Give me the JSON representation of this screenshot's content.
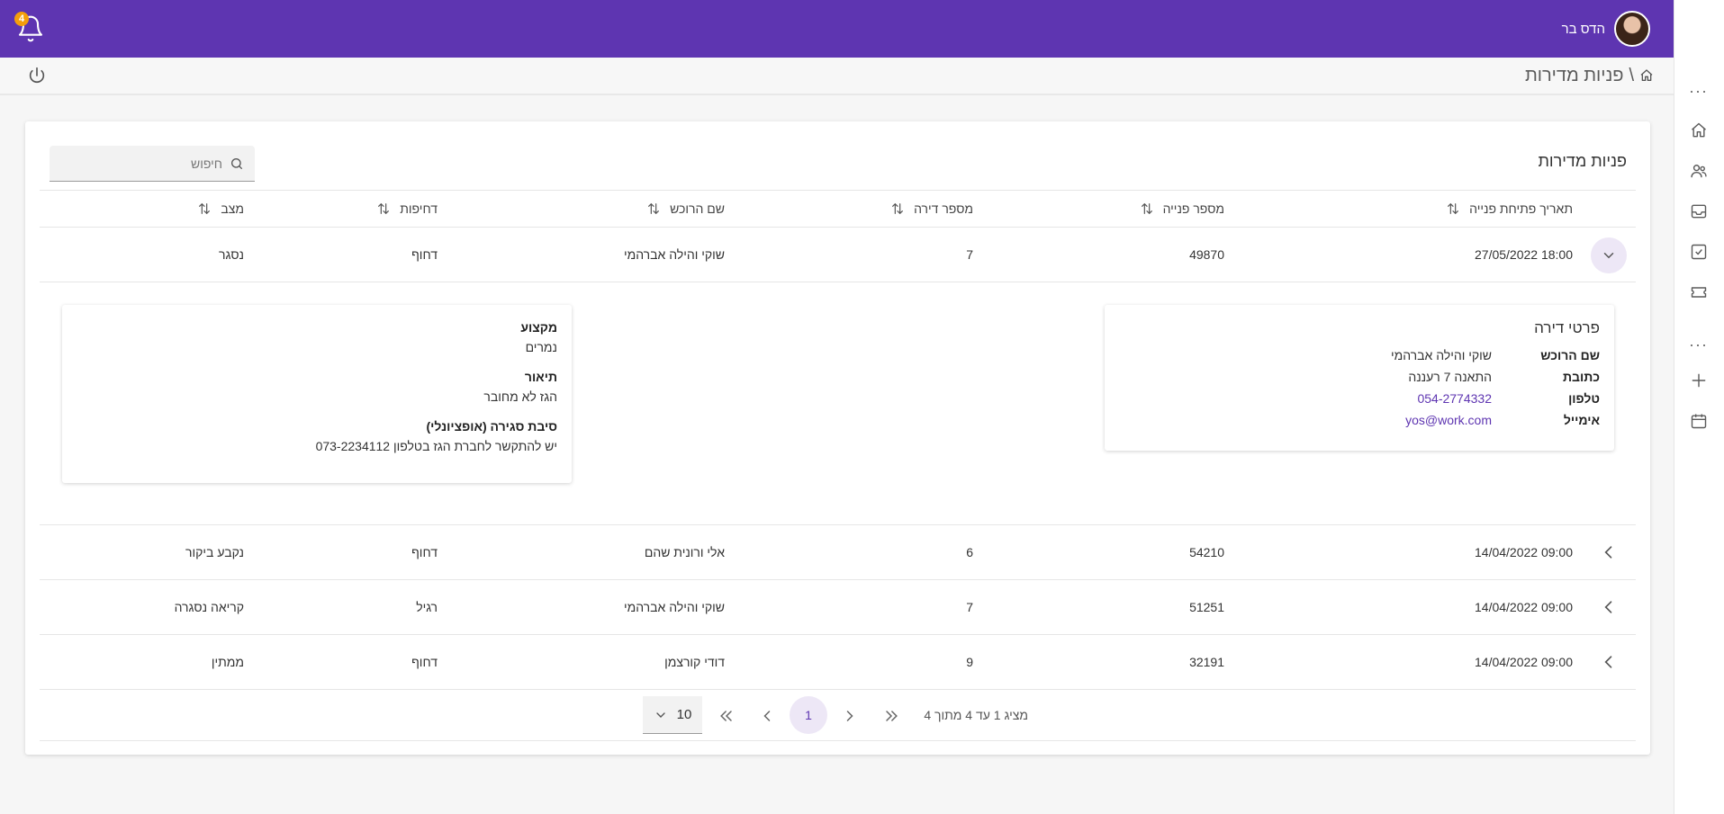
{
  "header": {
    "user_name": "הדס בר",
    "notification_count": "4",
    "bg_color": "#5e35b1"
  },
  "breadcrumb": {
    "home_icon": "home-icon",
    "separator": "\\",
    "title": "פניות מדירות",
    "power_icon": "power-icon"
  },
  "sidebar": {
    "items": [
      "dots",
      "home-icon",
      "people-icon",
      "inbox-icon",
      "task-check-icon",
      "ticket-icon",
      "dots",
      "plus-icon",
      "calendar-icon"
    ]
  },
  "card": {
    "title": "פניות מדירות",
    "search_placeholder": "חיפוש"
  },
  "table": {
    "columns": [
      "תאריך פתיחת פנייה",
      "מספר פנייה",
      "מספר דירה",
      "שם הרוכש",
      "דחיפות",
      "מצב"
    ],
    "rows": [
      {
        "date": "27/05/2022 18:00",
        "number": "49870",
        "apartment": "7",
        "owner": "שוקי והילה אברהמי",
        "priority": "דחוף",
        "status": "נסגר",
        "expanded": true
      },
      {
        "date": "14/04/2022 09:00",
        "number": "54210",
        "apartment": "6",
        "owner": "אלי ורונית שהם",
        "priority": "דחוף",
        "status": "נקבע ביקור",
        "expanded": false
      },
      {
        "date": "14/04/2022 09:00",
        "number": "51251",
        "apartment": "7",
        "owner": "שוקי והילה אברהמי",
        "priority": "רגיל",
        "status": "קריאה נסגרה",
        "expanded": false
      },
      {
        "date": "14/04/2022 09:00",
        "number": "32191",
        "apartment": "9",
        "owner": "דודי קורצמן",
        "priority": "דחוף",
        "status": "ממתין",
        "expanded": false
      }
    ]
  },
  "detail": {
    "apartment_panel": {
      "title": "פרטי דירה",
      "owner_label": "שם הרוכש",
      "owner_value": "שוקי והילה אברהמי",
      "address_label": "כתובת",
      "address_value": "התאנה 7 רעננה",
      "phone_label": "טלפון",
      "phone_value": "054-2774332",
      "email_label": "אימייל",
      "email_value": "yos@work.com"
    },
    "info_panel": {
      "profession_label": "מקצוע",
      "profession_value": "נמרים",
      "description_label": "תיאור",
      "description_value": "הגז לא מחובר",
      "close_reason_label": "סיבת סגירה (אופציונלי)",
      "close_reason_value": "יש להתקשר לחברת הגז בטלפון 073-2234112"
    }
  },
  "pagination": {
    "summary": "מציג 1 עד 4 מתוך 4",
    "current_page": "1",
    "page_size": "10"
  },
  "colors": {
    "accent": "#5e35b1",
    "accent_light": "#ede7f6",
    "badge": "#f59e0b"
  }
}
